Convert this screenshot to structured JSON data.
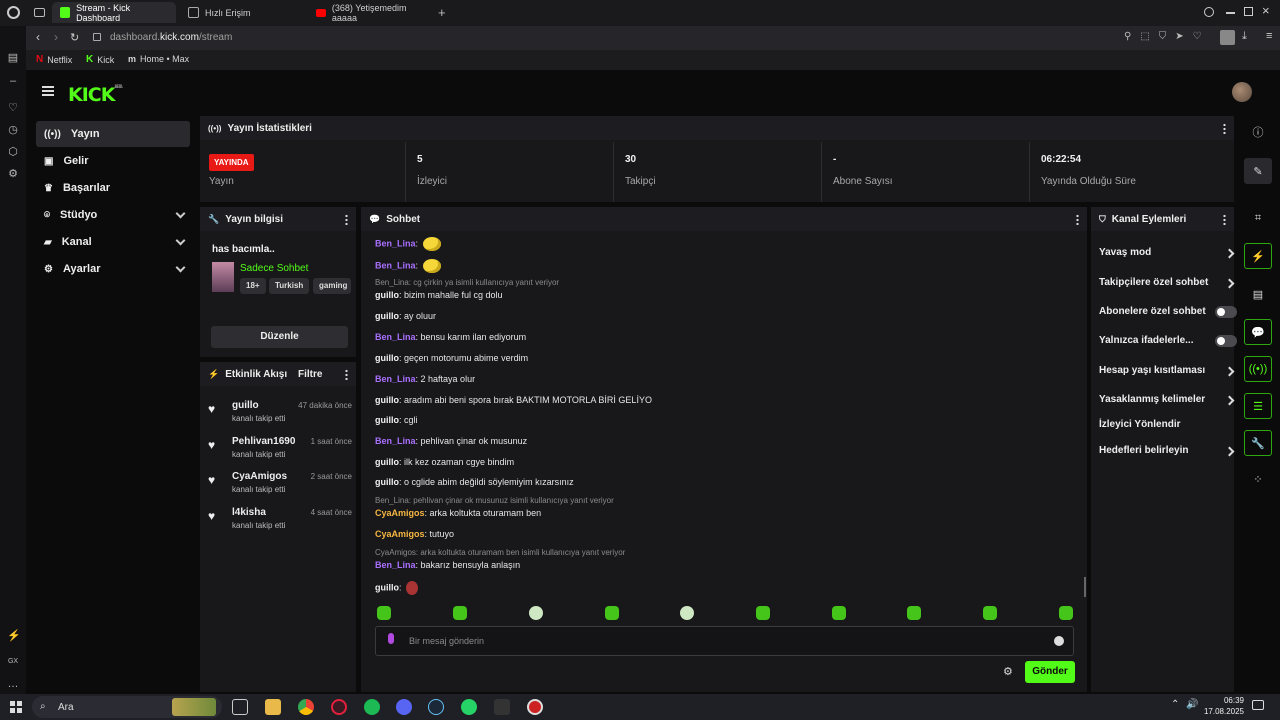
{
  "browser": {
    "tabs": [
      {
        "label": "Stream - Kick Dashboard",
        "icon": "kick-favicon"
      },
      {
        "label": "Hızlı Erişim",
        "icon": "grid-icon"
      },
      {
        "label": "(368) Yetişemedim aaaaa",
        "icon": "youtube-icon"
      }
    ],
    "url_prefix": "dashboard.",
    "url_host": "kick.com",
    "url_path": "/stream",
    "bookmarks": [
      "Netflix",
      "Kick",
      "Home • Max"
    ]
  },
  "brand": {
    "logo": "KICK",
    "beta": "BETA",
    "accent": "#53fc18"
  },
  "nav": {
    "items": [
      {
        "label": "Yayın",
        "icon": "broadcast-icon",
        "active": true
      },
      {
        "label": "Gelir",
        "icon": "wallet-icon"
      },
      {
        "label": "Başarılar",
        "icon": "trophy-icon"
      },
      {
        "label": "Stüdyo",
        "icon": "studio-icon",
        "expandable": true
      },
      {
        "label": "Kanal",
        "icon": "channel-icon",
        "expandable": true
      },
      {
        "label": "Ayarlar",
        "icon": "gear-icon",
        "expandable": true
      }
    ]
  },
  "stats": {
    "title": "Yayın İstatistikleri",
    "live_badge": "YAYINDA",
    "items": [
      {
        "value": "",
        "label": "Yayın"
      },
      {
        "value": "5",
        "label": "İzleyici"
      },
      {
        "value": "30",
        "label": "Takipçi"
      },
      {
        "value": "-",
        "label": "Abone Sayısı"
      },
      {
        "value": "06:22:54",
        "label": "Yayında Olduğu Süre"
      }
    ]
  },
  "stream_info": {
    "title": "Yayın bilgisi",
    "stream_title": "has bacımla..",
    "category": "Sadece Sohbet",
    "tags": [
      "18+",
      "Turkish",
      "gaming"
    ],
    "edit_label": "Düzenle"
  },
  "activity": {
    "title": "Etkinlik Akışı",
    "filter": "Filtre",
    "items": [
      {
        "name": "guillo",
        "desc": "kanalı takip etti",
        "time": "47 dakika önce"
      },
      {
        "name": "Pehlivan1690",
        "desc": "kanalı takip etti",
        "time": "1 saat önce"
      },
      {
        "name": "CyaAmigos",
        "desc": "kanalı takip etti",
        "time": "2 saat önce"
      },
      {
        "name": "l4kisha",
        "desc": "kanalı takip etti",
        "time": "4 saat önce"
      }
    ]
  },
  "chat": {
    "title": "Sohbet",
    "messages": [
      {
        "user": "Ben_Lina",
        "color": "#a970ff",
        "text": "",
        "emote": true
      },
      {
        "user": "Ben_Lina",
        "color": "#a970ff",
        "text": "",
        "emote": true
      },
      {
        "reply": "Ben_Lina: cg çirkin ya isimli kullanıcıya yanıt veriyor"
      },
      {
        "user": "guillo",
        "color": "#f2f2f2",
        "text": "bizim mahalle ful cg dolu"
      },
      {
        "user": "guillo",
        "color": "#f2f2f2",
        "text": "ay oluur"
      },
      {
        "user": "Ben_Lina",
        "color": "#a970ff",
        "text": "bensu karım ilan ediyorum"
      },
      {
        "user": "guillo",
        "color": "#f2f2f2",
        "text": "geçen motorumu abime verdim"
      },
      {
        "user": "Ben_Lina",
        "color": "#a970ff",
        "text": "2 haftaya olur"
      },
      {
        "user": "guillo",
        "color": "#f2f2f2",
        "text": "aradım abi beni spora bırak BAKTIM MOTORLA BİRİ GELİYO"
      },
      {
        "user": "guillo",
        "color": "#f2f2f2",
        "text": "cgli"
      },
      {
        "user": "Ben_Lina",
        "color": "#a970ff",
        "text": "pehlivan çinar ok musunuz"
      },
      {
        "user": "guillo",
        "color": "#f2f2f2",
        "text": "ilk kez ozaman cgye bindim"
      },
      {
        "user": "guillo",
        "color": "#f2f2f2",
        "text": "o cglide abim değildi söylemiyim kızarsınız"
      },
      {
        "reply": "Ben_Lina: pehlivan çinar ok musunuz isimli kullanıcıya yanıt veriyor"
      },
      {
        "user": "CyaAmigos",
        "color": "#f5b642",
        "text": "arka koltukta oturamam ben"
      },
      {
        "user": "CyaAmigos",
        "color": "#f5b642",
        "text": "tutuyo"
      },
      {
        "reply": "CyaAmigos: arka koltukta oturamam ben isimli kullanıcıya yanıt veriyor"
      },
      {
        "user": "Ben_Lina",
        "color": "#a970ff",
        "text": "bakarız bensuyla anlaşın"
      },
      {
        "user": "guillo",
        "color": "#f2f2f2",
        "text": "",
        "emote": true
      }
    ],
    "input_placeholder": "Bir mesaj gönderin",
    "send_label": "Gönder"
  },
  "channel_actions": {
    "title": "Kanal Eylemleri",
    "items": [
      {
        "label": "Yavaş mod",
        "type": "chevron"
      },
      {
        "label": "Takipçilere özel sohbet",
        "type": "chevron"
      },
      {
        "label": "Abonelere özel sohbet",
        "type": "toggle"
      },
      {
        "label": "Yalnızca ifadelerle...",
        "type": "toggle"
      },
      {
        "label": "Hesap yaşı kısıtlaması",
        "type": "chevron"
      },
      {
        "label": "Yasaklanmış kelimeler",
        "type": "chevron"
      },
      {
        "label": "İzleyici Yönlendir",
        "type": "none"
      },
      {
        "label": "Hedefleri belirleyin",
        "type": "chevron"
      }
    ]
  },
  "taskbar": {
    "search_label": "Ara",
    "time": "06:39",
    "date": "17.08.2025"
  }
}
